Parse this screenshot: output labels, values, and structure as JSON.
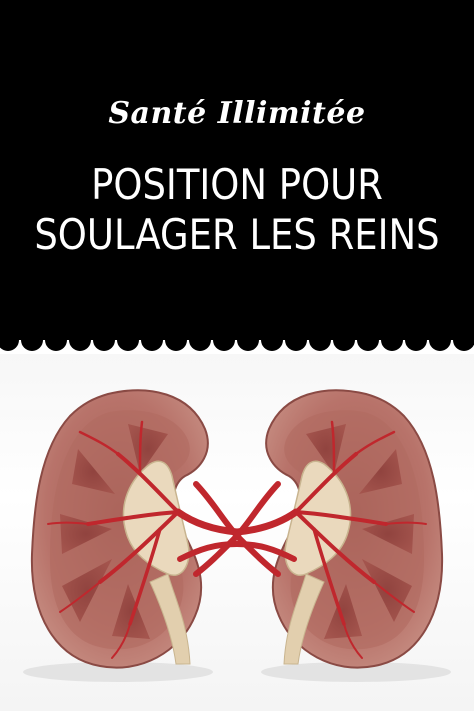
{
  "brand": {
    "name": "Santé Illimitée"
  },
  "headline": {
    "line1": "POSITION POUR",
    "line2": "SOULAGER LES REINS"
  },
  "colors": {
    "header_bg": "#000000",
    "text": "#ffffff",
    "artery": "#c0272d",
    "cortex": "#b96e63",
    "pelvis": "#e8dcc0"
  },
  "image": {
    "subject": "kidney-anatomy-illustration"
  }
}
